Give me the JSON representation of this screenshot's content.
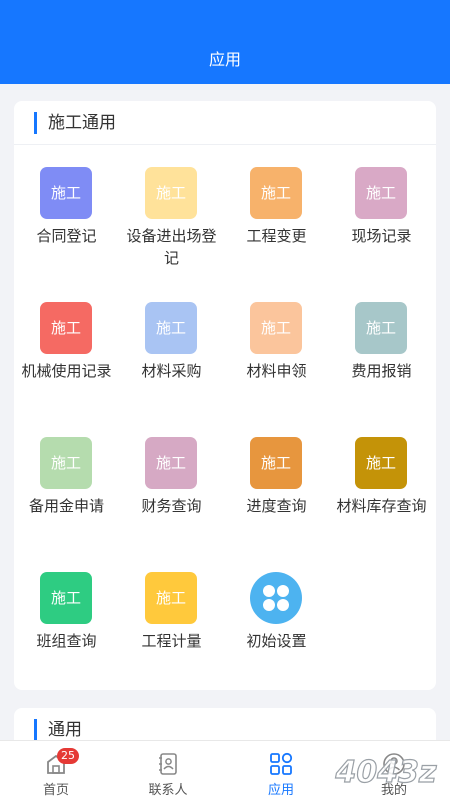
{
  "header": {
    "title": "应用"
  },
  "construction": {
    "title": "施工通用",
    "tile_text": "施工",
    "items": [
      {
        "label": "合同登记",
        "color": "#7f8cf5"
      },
      {
        "label": "设备进出场登记",
        "color": "#ffe29a"
      },
      {
        "label": "工程变更",
        "color": "#f7b26b"
      },
      {
        "label": "现场记录",
        "color": "#d9a9c6"
      },
      {
        "label": "机械使用记录",
        "color": "#f56a63"
      },
      {
        "label": "材料采购",
        "color": "#a9c4f3"
      },
      {
        "label": "材料申领",
        "color": "#fbc59c"
      },
      {
        "label": "费用报销",
        "color": "#a7c7c9"
      },
      {
        "label": "备用金申请",
        "color": "#b5dcae"
      },
      {
        "label": "财务查询",
        "color": "#d6a9c4"
      },
      {
        "label": "进度查询",
        "color": "#e7963e"
      },
      {
        "label": "材料库存查询",
        "color": "#c49308"
      },
      {
        "label": "班组查询",
        "color": "#2ecc82"
      },
      {
        "label": "工程计量",
        "color": "#ffc93c"
      },
      {
        "label": "初始设置",
        "icon": "settings-flower-icon",
        "color": "#4db3f0"
      }
    ]
  },
  "general": {
    "title": "通用"
  },
  "tabbar": {
    "items": [
      {
        "label": "首页",
        "icon": "home-icon",
        "badge": "25"
      },
      {
        "label": "联系人",
        "icon": "contacts-icon"
      },
      {
        "label": "应用",
        "icon": "apps-grid-icon",
        "active": true
      },
      {
        "label": "我的",
        "icon": "profile-icon"
      }
    ]
  },
  "watermark": {
    "text": "4043z"
  }
}
